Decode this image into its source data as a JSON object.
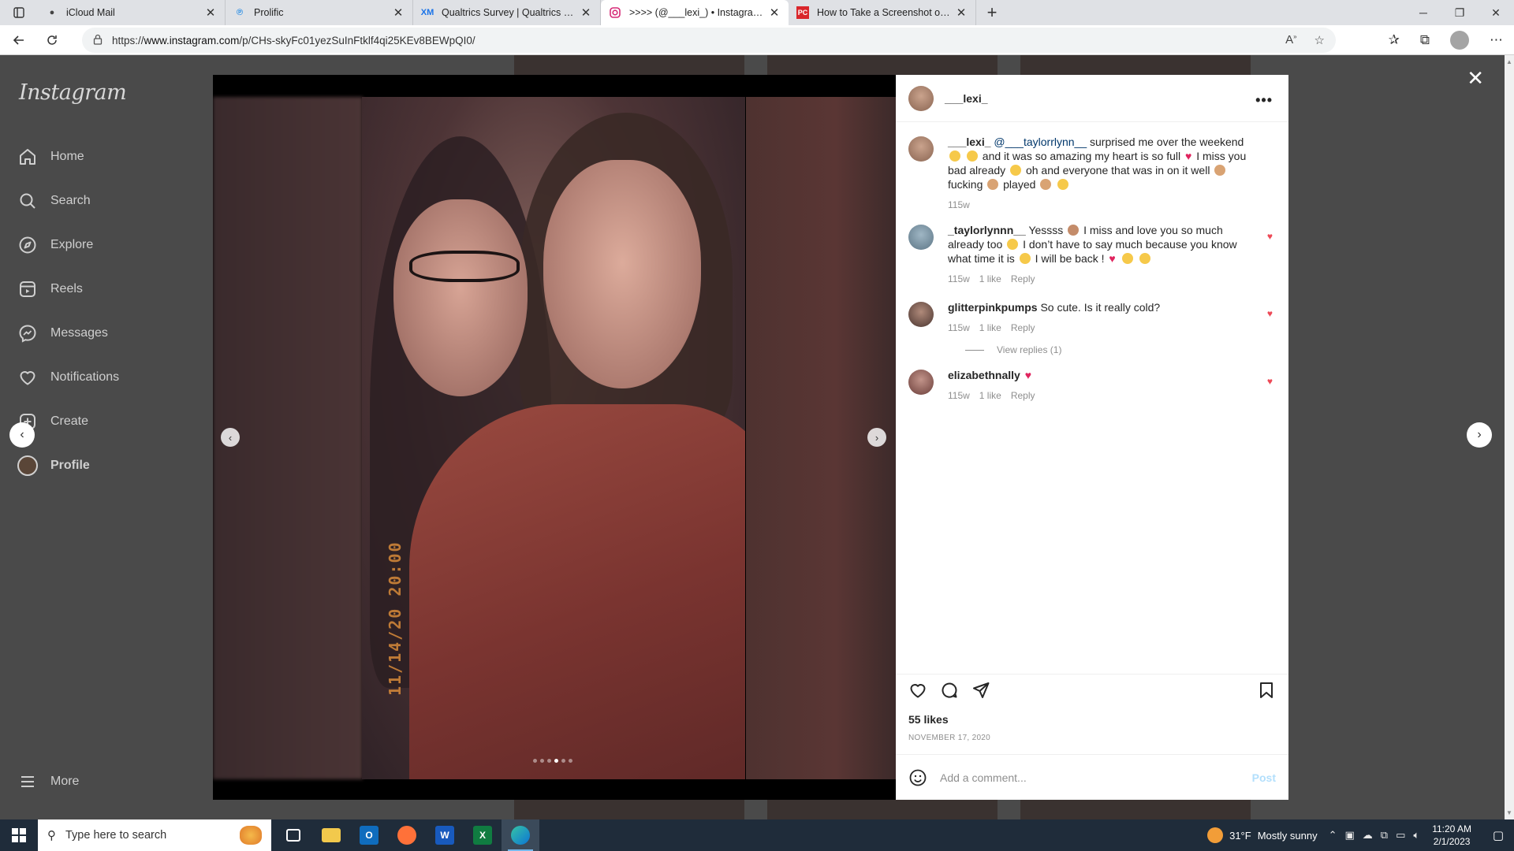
{
  "browser": {
    "tabs": [
      {
        "title": "iCloud Mail",
        "icon": "apple-icon",
        "active": false
      },
      {
        "title": "Prolific",
        "icon": "prolific-icon",
        "active": false
      },
      {
        "title": "Qualtrics Survey | Qualtrics Exper",
        "icon": "qualtrics-icon",
        "active": false
      },
      {
        "title": ">>>> (@___lexi_) • Instagram p",
        "icon": "instagram-icon",
        "active": true
      },
      {
        "title": "How to Take a Screenshot on An",
        "icon": "pcmag-icon",
        "active": false
      }
    ],
    "url_prefix": "https://",
    "url_host": "www.instagram.com",
    "url_path": "/p/CHs-skyFc01yezSuInFtklf4qi25KEv8BEWpQI0/"
  },
  "sidebar": {
    "logo": "Instagram",
    "items": [
      {
        "label": "Home",
        "icon": "home-icon"
      },
      {
        "label": "Search",
        "icon": "search-icon"
      },
      {
        "label": "Explore",
        "icon": "compass-icon"
      },
      {
        "label": "Reels",
        "icon": "reels-icon"
      },
      {
        "label": "Messages",
        "icon": "messenger-icon"
      },
      {
        "label": "Notifications",
        "icon": "heart-icon"
      },
      {
        "label": "Create",
        "icon": "plus-square-icon"
      },
      {
        "label": "Profile",
        "icon": "profile-avatar"
      }
    ],
    "more_label": "More"
  },
  "post": {
    "photo_stamp": "11/14/20 20:00",
    "carousel_count": 6,
    "carousel_active_index": 3,
    "author": "___lexi_",
    "caption": {
      "author": "___lexi_",
      "mention": "@___taylorrlynn__",
      "text_a": "surprised me over the weekend",
      "text_b": "and it was so amazing my heart is so full",
      "text_c": "I miss you bad already",
      "text_d": "oh and everyone that was in on it well",
      "text_e": "fucking",
      "text_f": "played",
      "time": "115w"
    },
    "comments": [
      {
        "user": "_taylorlynnn__",
        "text_a": "Yessss",
        "text_b": "I miss and love you so much already too",
        "text_c": "I don’t have to say much because you know what time it is",
        "text_d": "I will be back !",
        "time": "115w",
        "likes": "1 like",
        "reply": "Reply"
      },
      {
        "user": "glitterpinkpumps",
        "text": "So cute. Is it really cold?",
        "time": "115w",
        "likes": "1 like",
        "reply": "Reply",
        "view_replies": "View replies (1)"
      },
      {
        "user": "elizabethnally",
        "text": "",
        "time": "115w",
        "likes": "1 like",
        "reply": "Reply"
      }
    ],
    "likes": "55 likes",
    "date": "NOVEMBER 17, 2020",
    "add_comment_placeholder": "Add a comment...",
    "post_label": "Post"
  },
  "taskbar": {
    "search_placeholder": "Type here to search",
    "weather_temp": "31°F",
    "weather_text": "Mostly sunny",
    "time": "11:20 AM",
    "date": "2/1/2023"
  },
  "colors": {
    "like_red": "#ed4956",
    "mention_blue": "#00376b",
    "post_disabled": "#b2dffc",
    "taskbar": "#1f2c3a"
  }
}
